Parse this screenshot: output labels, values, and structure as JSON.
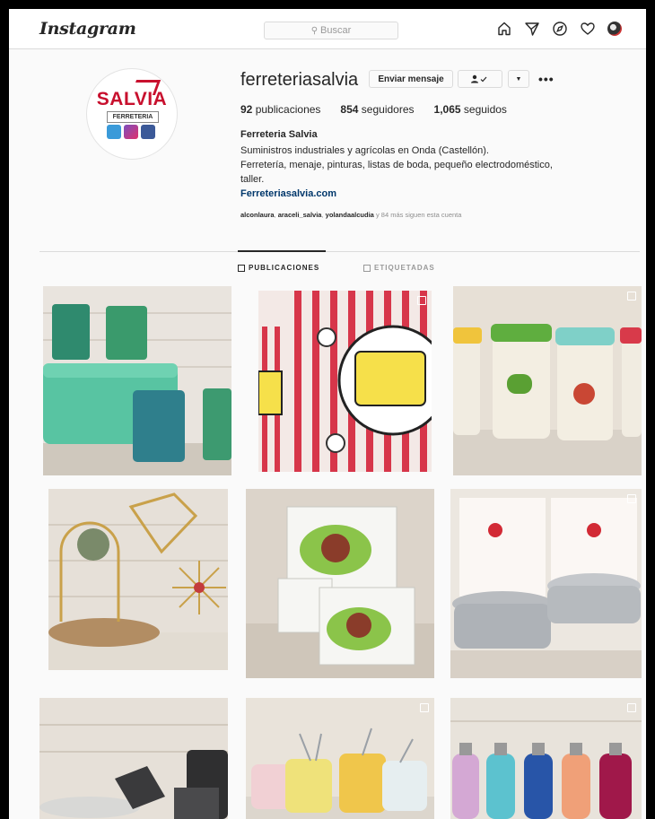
{
  "nav": {
    "logo": "Instagram",
    "search_placeholder": "Buscar",
    "icons": [
      "home-icon",
      "direct-icon",
      "explore-icon",
      "activity-heart-icon",
      "profile-avatar"
    ]
  },
  "profile": {
    "pic_brand": "SALVIA",
    "pic_sub": "FERRETERIA",
    "username": "ferreteriasalvia",
    "message_button": "Enviar mensaje",
    "posts_count": "92",
    "posts_label": "publicaciones",
    "followers_count": "854",
    "followers_label": "seguidores",
    "following_count": "1,065",
    "following_label": "seguidos",
    "full_name": "Ferreteria Salvia",
    "bio_line1": "Suministros industriales y agrícolas en Onda (Castellón).",
    "bio_line2": "Ferretería, menaje, pinturas, listas de boda, pequeño electrodoméstico,",
    "bio_line3": "taller.",
    "website": "Ferreteriasalvia.com",
    "followed_by_1": "alconlaura",
    "followed_by_2": "araceli_salvia",
    "followed_by_3": "yolandaalcudia",
    "followed_by_rest": "y 84 más siguen esta cuenta"
  },
  "tabs": {
    "posts": "PUBLICACIONES",
    "tagged": "ETIQUETADAS"
  },
  "posts": [
    {
      "name": "green-mugs-post",
      "subject": "green bread box and patterned mugs"
    },
    {
      "name": "popcorn-post",
      "subject": "popcorn bucket"
    },
    {
      "name": "travel-cups-post",
      "subject": "printed travel cups"
    },
    {
      "name": "gold-mirror-post",
      "subject": "gold mirror and decor"
    },
    {
      "name": "lekue-box-post",
      "subject": "boxed steamer"
    },
    {
      "name": "lacor-pots-post",
      "subject": "stainless pots"
    },
    {
      "name": "pans-post",
      "subject": "pans"
    },
    {
      "name": "fondue-post",
      "subject": "fondue sets"
    },
    {
      "name": "bottles-post",
      "subject": "colored bottles"
    }
  ],
  "colors": {
    "link": "#00376b",
    "brand_red": "#c8102e",
    "border": "#dbdbdb",
    "muted": "#8e8e8e"
  }
}
